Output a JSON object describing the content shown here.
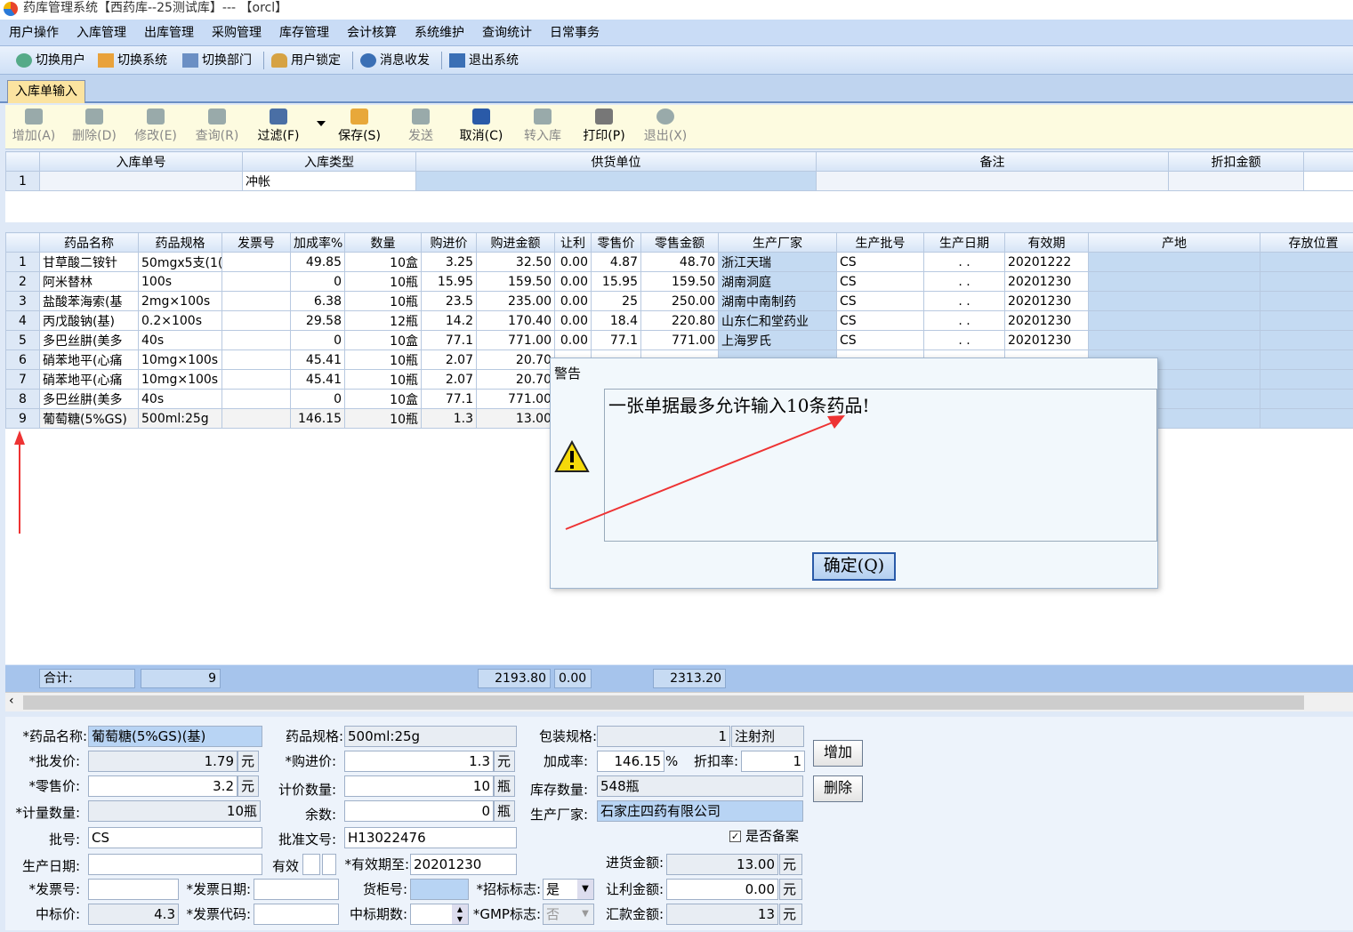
{
  "title": "药库管理系统【西药库--25测试库】--- 【orcl】",
  "menu": [
    "用户操作",
    "入库管理",
    "出库管理",
    "采购管理",
    "库存管理",
    "会计核算",
    "系统维护",
    "查询统计",
    "日常事务"
  ],
  "toolbar": [
    "切换用户",
    "切换系统",
    "切换部门",
    "用户锁定",
    "消息收发",
    "退出系统"
  ],
  "tab": "入库单输入",
  "actions": [
    "增加(A)",
    "删除(D)",
    "修改(E)",
    "查询(R)",
    "过滤(F)",
    "保存(S)",
    "发送",
    "取消(C)",
    "转入库",
    "打印(P)",
    "退出(X)"
  ],
  "header_cols": [
    "入库单号",
    "入库类型",
    "供货单位",
    "备注",
    "折扣金额"
  ],
  "header_row": {
    "n": "1",
    "type": "冲帐"
  },
  "cols": [
    "药品名称",
    "药品规格",
    "发票号",
    "加成率%",
    "数量",
    "购进价",
    "购进金额",
    "让利",
    "零售价",
    "零售金额",
    "生产厂家",
    "生产批号",
    "生产日期",
    "有效期",
    "产地",
    "存放位置"
  ],
  "rows": [
    [
      "1",
      "甘草酸二铵针",
      "50mgx5支(1(",
      "",
      "49.85",
      "10盒",
      "3.25",
      "32.50",
      "0.00",
      "4.87",
      "48.70",
      "浙江天瑞",
      "CS",
      ". .",
      "20201222"
    ],
    [
      "2",
      "阿米替林",
      "100s",
      "",
      "0",
      "10瓶",
      "15.95",
      "159.50",
      "0.00",
      "15.95",
      "159.50",
      "湖南洞庭",
      "CS",
      ". .",
      "20201230"
    ],
    [
      "3",
      "盐酸苯海索(基",
      "2mg×100s",
      "",
      "6.38",
      "10瓶",
      "23.5",
      "235.00",
      "0.00",
      "25",
      "250.00",
      "湖南中南制药",
      "CS",
      ". .",
      "20201230"
    ],
    [
      "4",
      "丙戊酸钠(基)",
      "0.2×100s",
      "",
      "29.58",
      "12瓶",
      "14.2",
      "170.40",
      "0.00",
      "18.4",
      "220.80",
      "山东仁和堂药业",
      "CS",
      ". .",
      "20201230"
    ],
    [
      "5",
      "多巴丝肼(美多",
      "40s",
      "",
      "0",
      "10盒",
      "77.1",
      "771.00",
      "0.00",
      "77.1",
      "771.00",
      "上海罗氏",
      "CS",
      ". .",
      "20201230"
    ],
    [
      "6",
      "硝苯地平(心痛",
      "10mg×100s",
      "",
      "45.41",
      "10瓶",
      "2.07",
      "20.70",
      "",
      "",
      "",
      "",
      "",
      "",
      ""
    ],
    [
      "7",
      "硝苯地平(心痛",
      "10mg×100s",
      "",
      "45.41",
      "10瓶",
      "2.07",
      "20.70",
      "",
      "",
      "",
      "",
      "",
      "",
      ""
    ],
    [
      "8",
      "多巴丝肼(美多",
      "40s",
      "",
      "0",
      "10盒",
      "77.1",
      "771.00",
      "",
      "",
      "",
      "",
      "",
      "",
      ""
    ],
    [
      "9",
      "葡萄糖(5%GS)",
      "500ml:25g",
      "",
      "146.15",
      "10瓶",
      "1.3",
      "13.00",
      "",
      "",
      "",
      "",
      "",
      "",
      ""
    ]
  ],
  "summary": {
    "label": "合计:",
    "count": "9",
    "amount": "2193.80",
    "rebate": "0.00",
    "retail": "2313.20"
  },
  "dialog": {
    "title": "警告",
    "message": "一张单据最多允许输入10条药品!",
    "ok": "确定(Q)"
  },
  "form": {
    "name_l": "*药品名称:",
    "name": "葡萄糖(5%GS)(基)",
    "spec_l": "药品规格:",
    "spec": "500ml:25g",
    "pack_l": "包装规格:",
    "pack": "1",
    "pack_unit": "注射剂",
    "wholesale_l": "*批发价:",
    "wholesale": "1.79",
    "yuan": "元",
    "buy_l": "*购进价:",
    "buy": "1.3",
    "markup_l": "加成率:",
    "markup": "146.15",
    "pct": "%",
    "discount_l": "折扣率:",
    "discount": "1",
    "retail_l": "*零售价:",
    "retail": "3.2",
    "qty_l": "计价数量:",
    "qty": "10",
    "bottle": "瓶",
    "stock_l": "库存数量:",
    "stock": "548瓶",
    "mqty_l": "*计量数量:",
    "mqty": "10瓶",
    "rem_l": "余数:",
    "rem": "0",
    "maker_l": "生产厂家:",
    "maker": "石家庄四药有限公司",
    "batch_l": "批号:",
    "batch": "CS",
    "approval_l": "批准文号:",
    "approval": "H13022476",
    "record": "是否备案",
    "mdate_l": "生产日期:",
    "valid_l": "有效",
    "expire_l": "*有效期至:",
    "expire": "20201230",
    "inamt_l": "进货金额:",
    "inamt": "13.00",
    "inv_l": "*发票号:",
    "invdate_l": "*发票日期:",
    "shelf_l": "货柜号:",
    "bid_l": "*招标标志:",
    "bid": "是",
    "rebate_l": "让利金额:",
    "rebate": "0.00",
    "bidprice_l": "中标价:",
    "bidprice": "4.3",
    "invcode_l": "*发票代码:",
    "bidperiod_l": "中标期数:",
    "gmp_l": "*GMP标志:",
    "gmp": "否",
    "remit_l": "汇款金额:",
    "remit": "13",
    "add": "增加",
    "del": "删除"
  }
}
